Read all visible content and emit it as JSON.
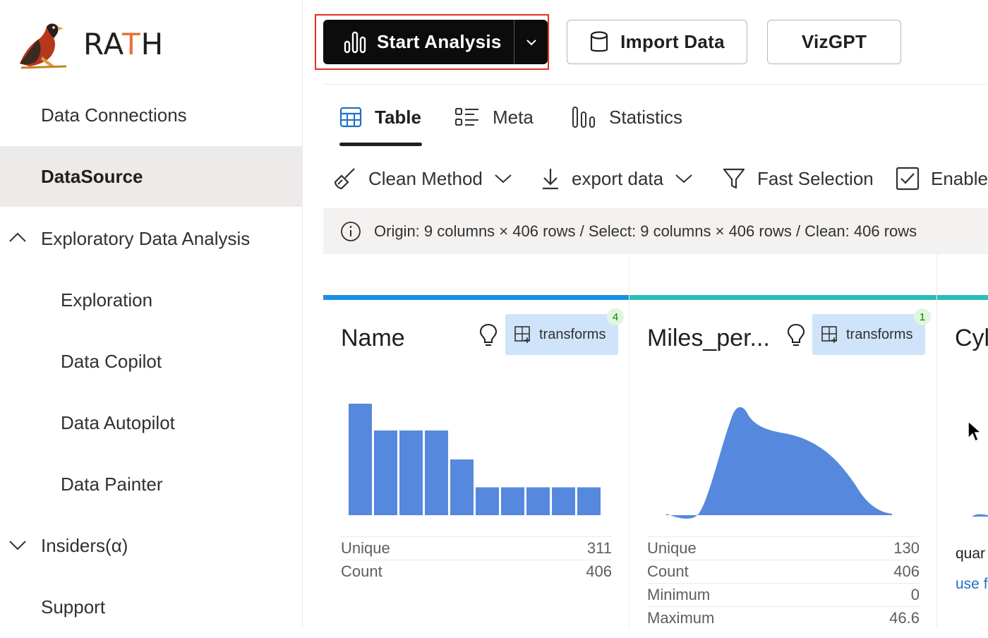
{
  "app": {
    "brand_prefix": "RA",
    "brand_accent": "T",
    "brand_suffix": "H"
  },
  "sidebar": {
    "items": [
      {
        "label": "Data Connections"
      },
      {
        "label": "DataSource"
      },
      {
        "label": "Exploratory Data Analysis"
      },
      {
        "label": "Exploration"
      },
      {
        "label": "Data Copilot"
      },
      {
        "label": "Data Autopilot"
      },
      {
        "label": "Data Painter"
      },
      {
        "label": "Insiders(α)"
      },
      {
        "label": "Support"
      }
    ]
  },
  "toolbar_top": {
    "start_analysis": "Start Analysis",
    "import_data": "Import Data",
    "vizgpt": "VizGPT"
  },
  "tabs": [
    {
      "label": "Table"
    },
    {
      "label": "Meta"
    },
    {
      "label": "Statistics"
    }
  ],
  "tools": {
    "clean_method": "Clean Method",
    "export_data": "export data",
    "fast_selection": "Fast Selection",
    "enable": "Enable"
  },
  "info": {
    "summary": "Origin: 9 columns × 406 rows / Select: 9 columns × 406 rows / Clean: 406 rows"
  },
  "columns": [
    {
      "title": "Name",
      "transforms_label": "transforms",
      "transforms_count": "4",
      "accent": "#1e8fe6",
      "histogram": [
        100,
        76,
        76,
        76,
        50,
        25,
        25,
        25,
        25,
        25
      ],
      "stats": [
        {
          "label": "Unique",
          "value": "311"
        },
        {
          "label": "Count",
          "value": "406"
        }
      ]
    },
    {
      "title": "Miles_per...",
      "transforms_label": "transforms",
      "transforms_count": "1",
      "accent": "#2bbcb8",
      "stats": [
        {
          "label": "Unique",
          "value": "130"
        },
        {
          "label": "Count",
          "value": "406"
        },
        {
          "label": "Minimum",
          "value": "0"
        },
        {
          "label": "Maximum",
          "value": "46.6"
        }
      ]
    },
    {
      "title": "Cyl",
      "line1": "quar",
      "line2": "use f"
    }
  ],
  "colors": {
    "chart_fill": "#5688dd",
    "highlight": "#e1301e"
  }
}
